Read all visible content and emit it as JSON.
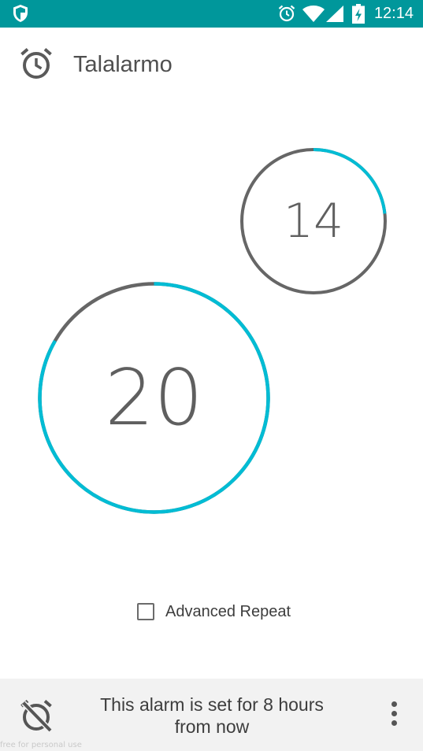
{
  "status_bar": {
    "time": "12:14",
    "icons": [
      "shield-icon",
      "alarm-icon",
      "wifi-icon",
      "signal-icon",
      "battery-charging-icon"
    ],
    "color": "#00979b"
  },
  "app_bar": {
    "title": "Talalarmo",
    "icon": "alarm-clock-icon"
  },
  "minutes_dial": {
    "value": "14",
    "progress": 0.233,
    "accent": "#00bcd4",
    "track": "#666666"
  },
  "hours_dial": {
    "value": "20",
    "progress": 0.833,
    "accent": "#00bcd4",
    "track": "#666666"
  },
  "advanced_repeat": {
    "label": "Advanced Repeat",
    "checked": false
  },
  "bottom_bar": {
    "message_line1": "This alarm is set for 8 hours",
    "message_line2": "from now",
    "toggle_icon": "alarm-off-icon",
    "menu_icon": "more-vert-icon"
  },
  "watermark": "free for personal use"
}
